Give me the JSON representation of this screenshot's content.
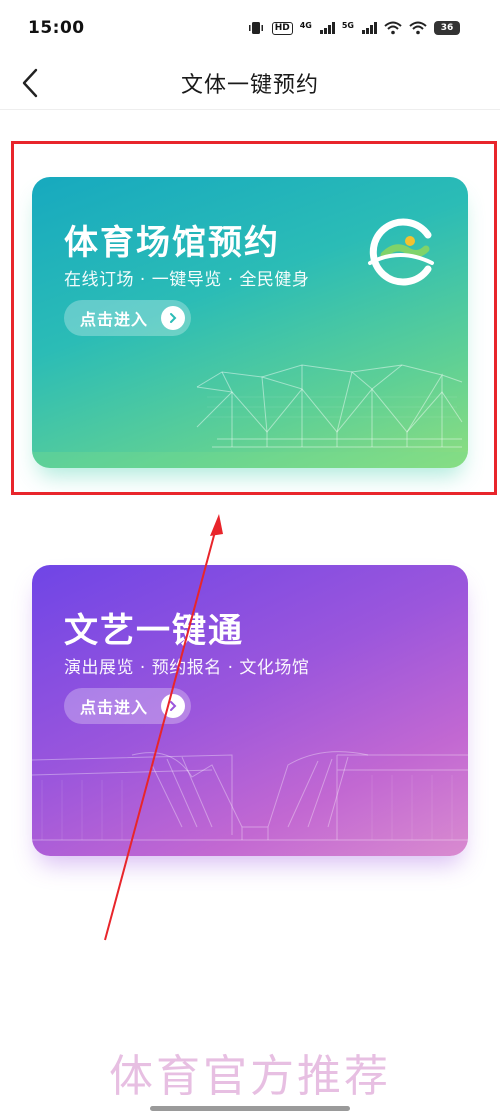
{
  "status_bar": {
    "time": "15:00",
    "hd_label": "HD",
    "net_4g": "4G",
    "net_5g": "5G",
    "battery": "36"
  },
  "nav": {
    "title": "文体一键预约"
  },
  "cards": [
    {
      "title": "体育场馆预约",
      "subtitle": "在线订场 · 一键导览 · 全民健身",
      "button_label": "点击进入"
    },
    {
      "title": "文艺一键通",
      "subtitle": "演出展览 · 预约报名 · 文化场馆",
      "button_label": "点击进入"
    }
  ],
  "watermark": "体育官方推荐",
  "colors": {
    "highlight": "#e8252b",
    "sports_card": "#2bbcb6",
    "arts_card": "#9b56dc",
    "watermark": "#e7bfe2"
  }
}
